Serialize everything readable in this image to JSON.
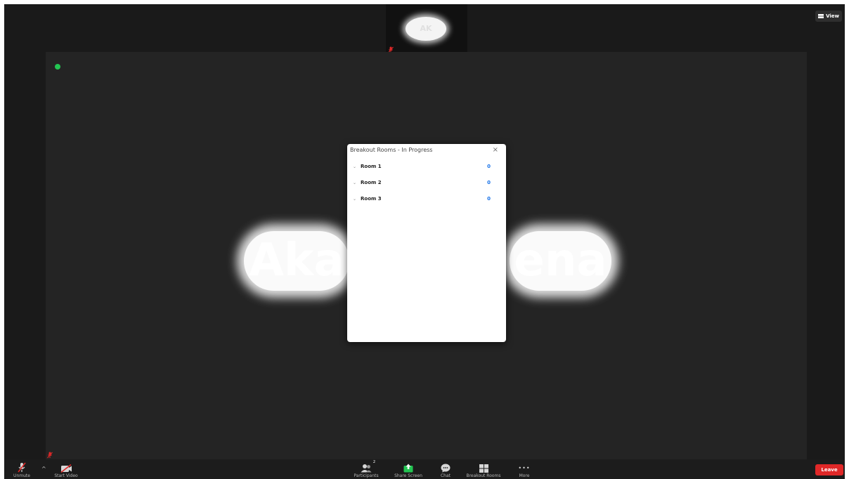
{
  "meeting": {
    "view_label": "View",
    "thumb_name": "AK",
    "big_name_left": "Aka",
    "big_name_right": "ena"
  },
  "breakout_panel": {
    "title": "Breakout Rooms - In Progress",
    "close_glyph": "×",
    "expand_glyph": "⌄",
    "rooms": [
      {
        "label": "Room 1",
        "count": "0"
      },
      {
        "label": "Room 2",
        "count": "0"
      },
      {
        "label": "Room 3",
        "count": "0"
      }
    ]
  },
  "toolbar": {
    "unmute_label": "Unmute",
    "start_video_label": "Start Video",
    "participants_label": "Participants",
    "participants_count": "2",
    "share_screen_label": "Share Screen",
    "chat_label": "Chat",
    "breakout_rooms_label": "Breakout Rooms",
    "more_label": "More",
    "more_glyph": "•••",
    "caret_glyph": "^",
    "leave_label": "Leave"
  },
  "colors": {
    "stage_bg": "#242424",
    "window_bg": "#1a1a1a",
    "leave_red": "#e02828",
    "share_green": "#23c552",
    "room_count_blue": "#1a73e8"
  },
  "icons": {
    "view_btn": "grid-icon",
    "mute": "microphone-muted-icon",
    "video": "video-off-icon",
    "participants": "people-icon",
    "share": "share-screen-icon",
    "chat": "chat-bubble-icon",
    "breakout": "breakout-rooms-icon",
    "more": "more-dots-icon",
    "security": "shield-icon"
  }
}
